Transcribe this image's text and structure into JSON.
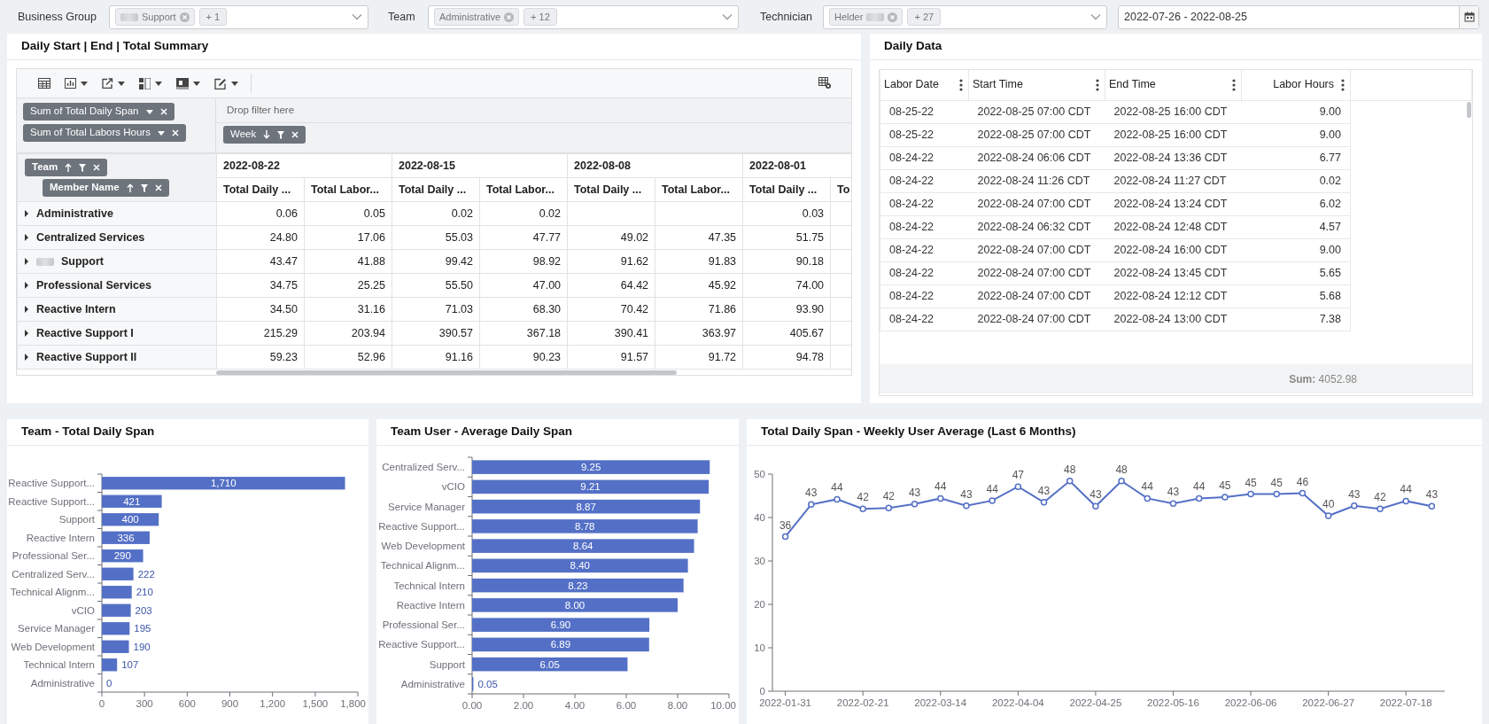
{
  "filters": [
    {
      "label": "Business Group",
      "chips": [
        {
          "text": "Support",
          "blur_before": true,
          "blur_after": false
        }
      ],
      "more": "+ 1"
    },
    {
      "label": "Team",
      "chips": [
        {
          "text": "Administrative",
          "blur_before": false,
          "blur_after": false
        }
      ],
      "more": "+ 12"
    },
    {
      "label": "Technician",
      "chips": [
        {
          "text": "Helder",
          "blur_before": false,
          "blur_after": true
        }
      ],
      "more": "+ 27"
    }
  ],
  "date_range": {
    "value": "2022-07-26 - 2022-08-25"
  },
  "summary": {
    "title": "Daily Start | End | Total Summary",
    "measures": [
      {
        "text": "Sum of Total Daily Span"
      },
      {
        "text": "Sum of Total Labors Hours"
      }
    ],
    "filter_placeholder": "Drop filter here",
    "column_fields": [
      {
        "text": "Week",
        "sort_ascending": false
      }
    ],
    "row_fields": [
      {
        "text": "Team",
        "sort_ascending": true
      },
      {
        "text": "Member Name",
        "sort_ascending": true
      }
    ],
    "column_groups": [
      {
        "label": "2022-08-22",
        "columns": [
          "Total Daily ...",
          "Total Labor..."
        ]
      },
      {
        "label": "2022-08-15",
        "columns": [
          "Total Daily ...",
          "Total Labor..."
        ]
      },
      {
        "label": "2022-08-08",
        "columns": [
          "Total Daily ...",
          "Total Labor..."
        ]
      },
      {
        "label": "2022-08-01",
        "columns": [
          "Total Daily ...",
          "To"
        ]
      }
    ],
    "rows": [
      {
        "label": "Administrative",
        "blur_before": false,
        "expanded": false,
        "cells": [
          "0.06",
          "0.05",
          "0.02",
          "0.02",
          null,
          null,
          "0.03"
        ]
      },
      {
        "label": "Centralized Services",
        "blur_before": false,
        "expanded": false,
        "cells": [
          "24.80",
          "17.06",
          "55.03",
          "47.77",
          "49.02",
          "47.35",
          "51.75"
        ]
      },
      {
        "label": "Support",
        "blur_before": true,
        "expanded": false,
        "cells": [
          "43.47",
          "41.88",
          "99.42",
          "98.92",
          "91.62",
          "91.83",
          "90.18"
        ]
      },
      {
        "label": "Professional Services",
        "blur_before": false,
        "expanded": false,
        "cells": [
          "34.75",
          "25.25",
          "55.50",
          "47.00",
          "64.42",
          "45.92",
          "74.00"
        ]
      },
      {
        "label": "Reactive Intern",
        "blur_before": false,
        "expanded": false,
        "cells": [
          "34.50",
          "31.16",
          "71.03",
          "68.30",
          "70.42",
          "71.86",
          "93.90"
        ]
      },
      {
        "label": "Reactive Support I",
        "blur_before": false,
        "expanded": false,
        "cells": [
          "215.29",
          "203.94",
          "390.57",
          "367.18",
          "390.41",
          "363.97",
          "405.67"
        ]
      },
      {
        "label": "Reactive Support II",
        "blur_before": false,
        "expanded": false,
        "cells": [
          "59.23",
          "52.96",
          "91.16",
          "90.23",
          "91.57",
          "91.72",
          "94.78"
        ]
      }
    ]
  },
  "daily_data": {
    "title": "Daily Data",
    "columns": [
      {
        "label": "Labor Date",
        "kind": "text"
      },
      {
        "label": "Start Time",
        "kind": "text"
      },
      {
        "label": "End Time",
        "kind": "text"
      },
      {
        "label": "Labor Hours",
        "kind": "number"
      }
    ],
    "rows": [
      [
        "08-25-22",
        "2022-08-25 07:00 CDT",
        "2022-08-25 16:00 CDT",
        "9.00"
      ],
      [
        "08-25-22",
        "2022-08-25 07:00 CDT",
        "2022-08-25 16:00 CDT",
        "9.00"
      ],
      [
        "08-24-22",
        "2022-08-24 06:06 CDT",
        "2022-08-24 13:36 CDT",
        "6.77"
      ],
      [
        "08-24-22",
        "2022-08-24 11:26 CDT",
        "2022-08-24 11:27 CDT",
        "0.02"
      ],
      [
        "08-24-22",
        "2022-08-24 07:00 CDT",
        "2022-08-24 13:24 CDT",
        "6.02"
      ],
      [
        "08-24-22",
        "2022-08-24 06:32 CDT",
        "2022-08-24 12:48 CDT",
        "4.57"
      ],
      [
        "08-24-22",
        "2022-08-24 07:00 CDT",
        "2022-08-24 16:00 CDT",
        "9.00"
      ],
      [
        "08-24-22",
        "2022-08-24 07:00 CDT",
        "2022-08-24 13:45 CDT",
        "5.65"
      ],
      [
        "08-24-22",
        "2022-08-24 07:00 CDT",
        "2022-08-24 12:12 CDT",
        "5.68"
      ],
      [
        "08-24-22",
        "2022-08-24 07:00 CDT",
        "2022-08-24 13:00 CDT",
        "7.38"
      ]
    ],
    "footer": "**Sum:** 4052.98"
  },
  "charts": [
    {
      "chart_data": {
        "type": "bar",
        "orientation": "horizontal",
        "title": "Team - Total Daily Span",
        "categories": [
          "Reactive Support...",
          "Reactive Support...",
          "Support",
          "Reactive Intern",
          "Professional Ser...",
          "Centralized Serv...",
          "Technical Alignm...",
          "vCIO",
          "Service Manager",
          "Web Development",
          "Technical Intern",
          "Administrative"
        ],
        "values": [
          1710,
          421,
          400,
          336,
          290,
          222,
          210,
          203,
          195,
          190,
          107,
          0
        ],
        "value_labels": [
          "1,710",
          "421",
          "400",
          "336",
          "290",
          "222",
          "210",
          "203",
          "195",
          "190",
          "107",
          "0"
        ],
        "xlim": [
          0,
          1800
        ],
        "xticks": [
          {
            "value": 0,
            "label": "0"
          },
          {
            "value": 300,
            "label": "300"
          },
          {
            "value": 600,
            "label": "600"
          },
          {
            "value": 900,
            "label": "900"
          },
          {
            "value": 1200,
            "label": "1,200"
          },
          {
            "value": 1500,
            "label": "1,500"
          },
          {
            "value": 1800,
            "label": "1,800"
          }
        ]
      }
    },
    {
      "chart_data": {
        "type": "bar",
        "orientation": "horizontal",
        "title": "Team User - Average Daily Span",
        "categories": [
          "Centralized Serv...",
          "vCIO",
          "Service Manager",
          "Reactive Support...",
          "Web Development",
          "Technical Alignm...",
          "Technical Intern",
          "Reactive Intern",
          "Professional Ser...",
          "Reactive Support...",
          "Support",
          "Administrative"
        ],
        "values": [
          9.25,
          9.21,
          8.87,
          8.78,
          8.64,
          8.4,
          8.23,
          8.0,
          6.9,
          6.89,
          6.05,
          0.05
        ],
        "value_labels": [
          "9.25",
          "9.21",
          "8.87",
          "8.78",
          "8.64",
          "8.40",
          "8.23",
          "8.00",
          "6.90",
          "6.89",
          "6.05",
          "0.05"
        ],
        "xlim": [
          0,
          10
        ],
        "xticks": [
          {
            "value": 0,
            "label": "0.00"
          },
          {
            "value": 2,
            "label": "2.00"
          },
          {
            "value": 4,
            "label": "4.00"
          },
          {
            "value": 6,
            "label": "6.00"
          },
          {
            "value": 8,
            "label": "8.00"
          },
          {
            "value": 10,
            "label": "10.00"
          }
        ]
      }
    },
    {
      "chart_data": {
        "type": "line",
        "title": "Total Daily Span - Weekly User Average (Last 6 Months)",
        "marker": true,
        "categories": [
          "2022-01-31",
          null,
          null,
          "2022-02-21",
          null,
          null,
          "2022-03-14",
          null,
          null,
          "2022-04-04",
          null,
          null,
          "2022-04-25",
          null,
          null,
          "2022-05-16",
          null,
          null,
          "2022-06-06",
          null,
          null,
          "2022-06-27",
          null,
          null,
          "2022-07-18",
          null
        ],
        "series": [
          {
            "color": "#5470c6",
            "values": [
              35.6,
              43.0,
              44.2,
              42.0,
              42.2,
              43.1,
              44.4,
              42.7,
              43.9,
              47.1,
              43.5,
              48.4,
              42.6,
              48.4,
              44.4,
              43.2,
              44.4,
              44.7,
              45.4,
              45.4,
              45.6,
              40.4,
              42.7,
              42.0,
              43.8,
              42.6
            ]
          }
        ],
        "value_labels": [
          "36",
          "43",
          "44",
          "42",
          "42",
          "43",
          "44",
          "43",
          "44",
          "47",
          "43",
          "48",
          "43",
          "48",
          "44",
          "43",
          "44",
          "45",
          "45",
          "45",
          "46",
          "40",
          "43",
          "42",
          "44",
          "43"
        ],
        "ylim": [
          0,
          50
        ],
        "yticks": [
          0,
          10,
          20,
          30,
          40,
          50
        ]
      }
    }
  ]
}
